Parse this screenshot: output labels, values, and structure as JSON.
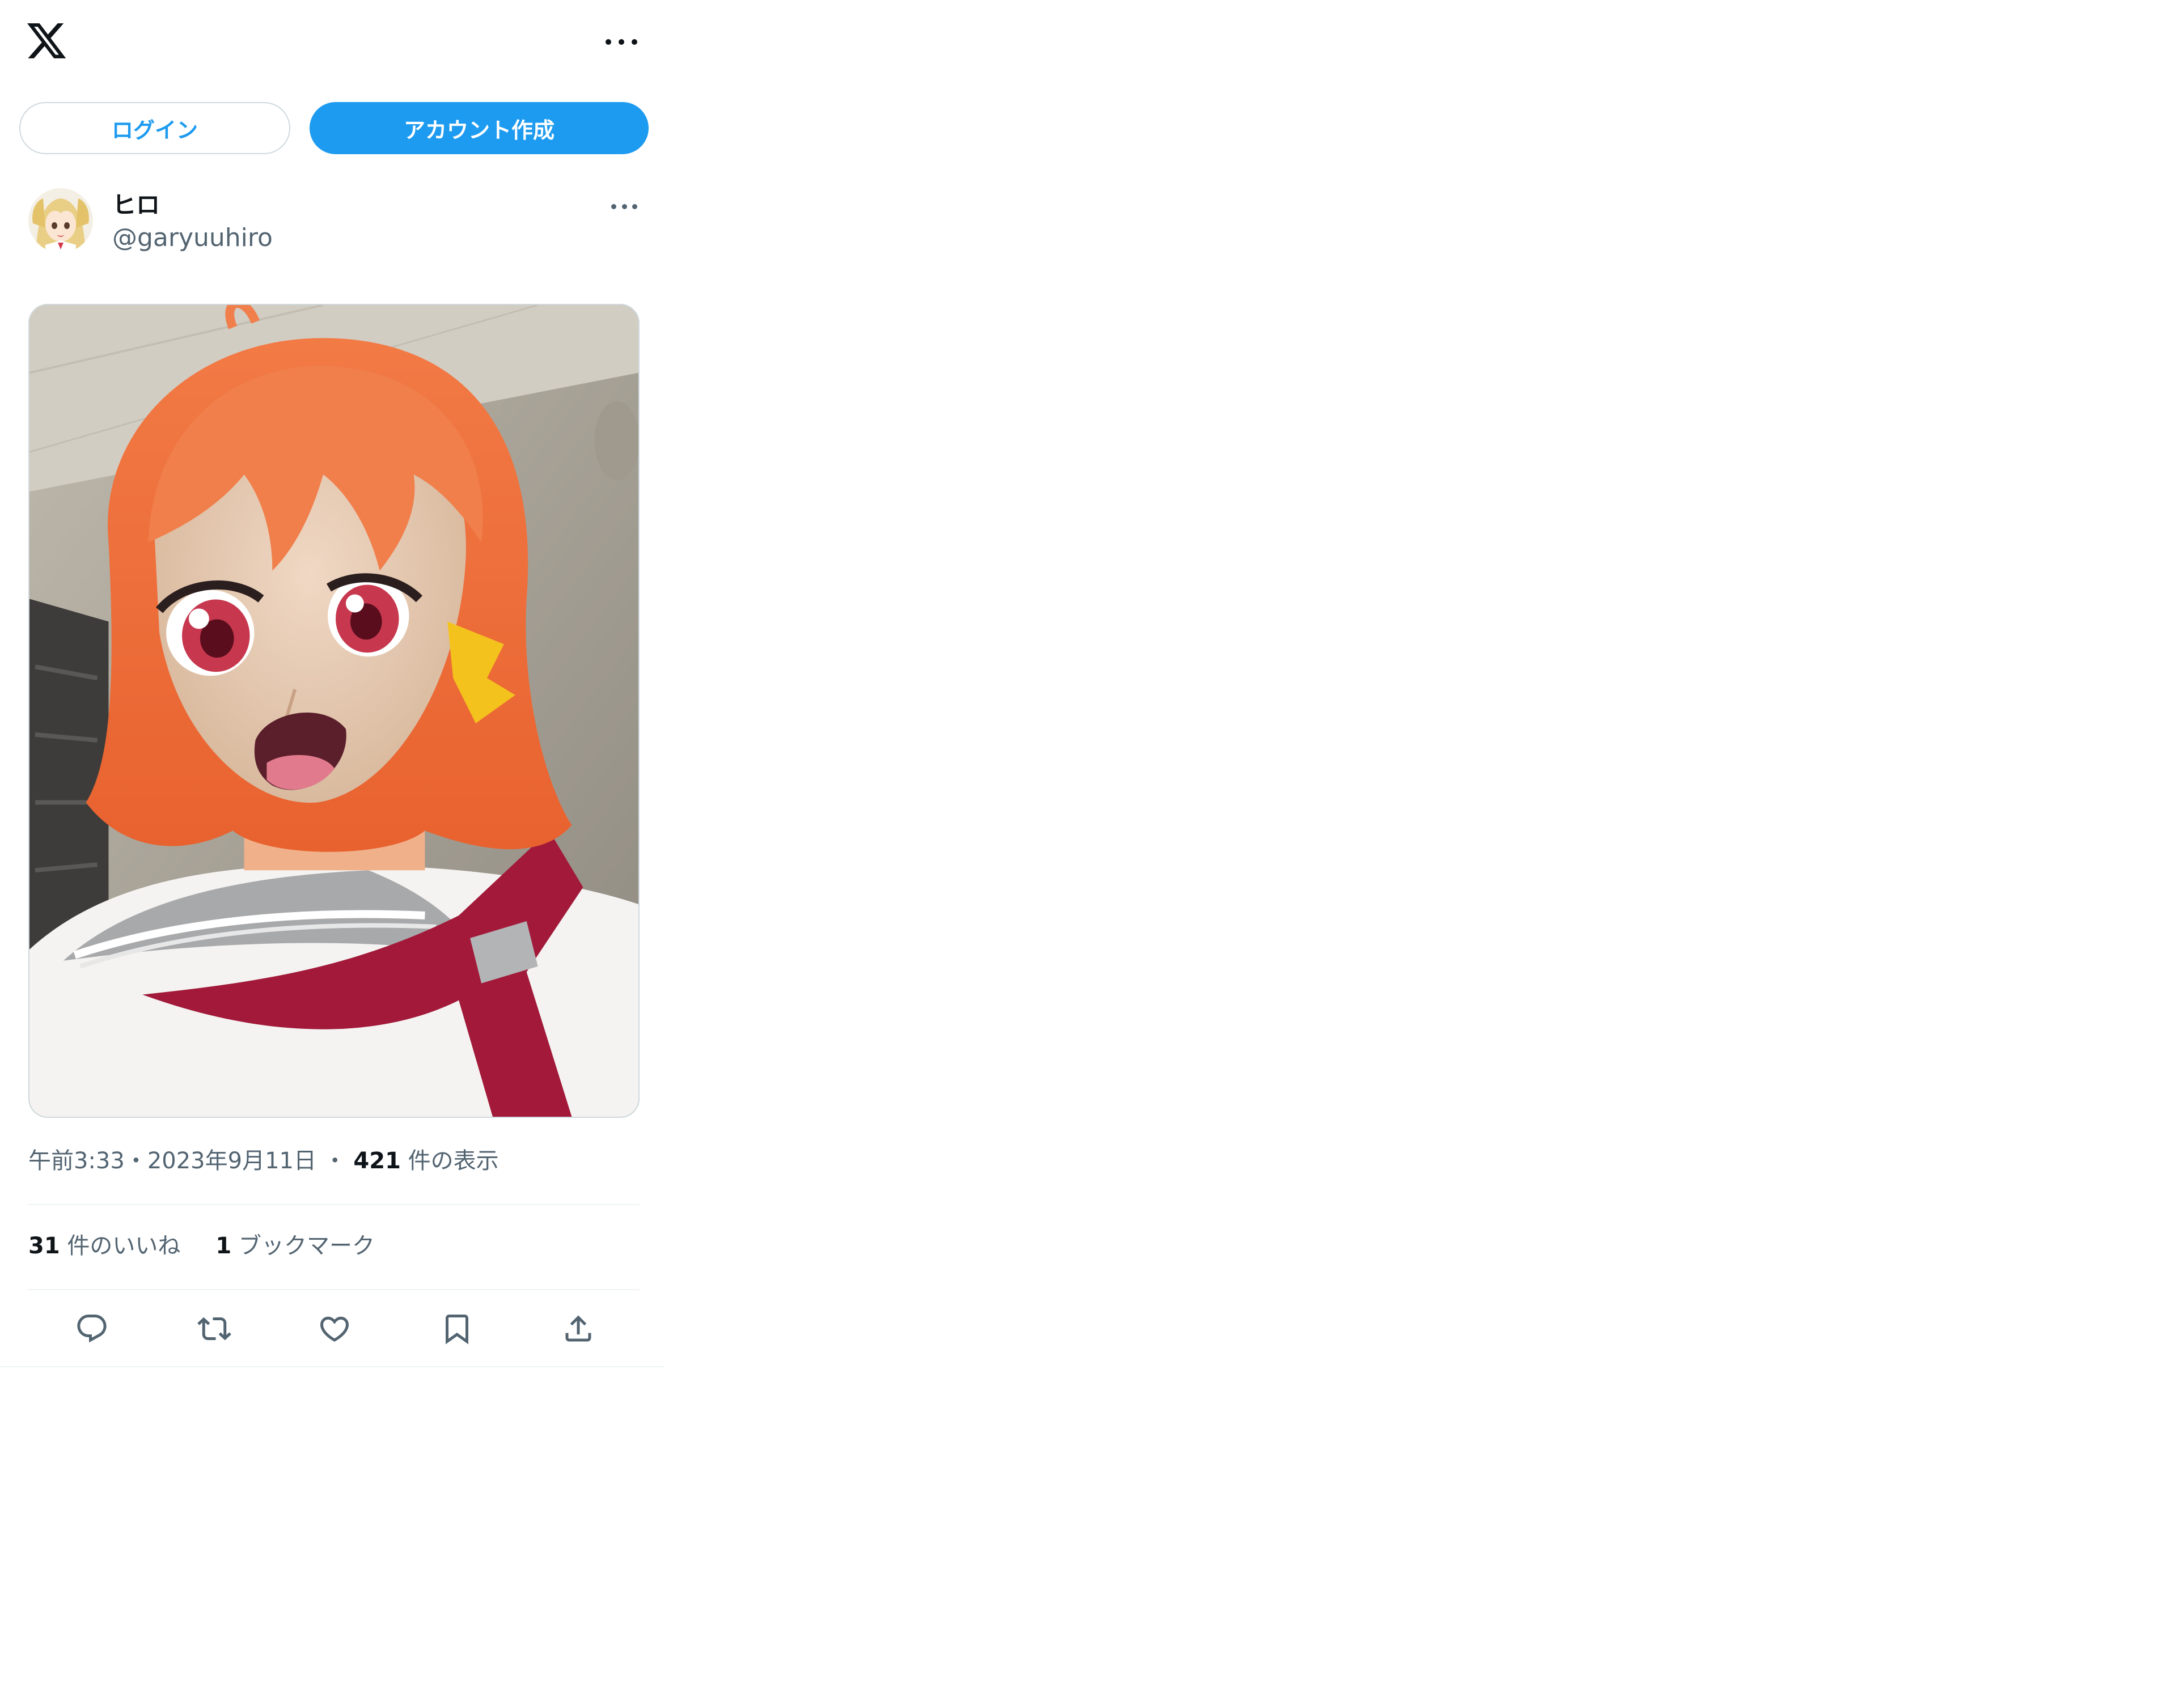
{
  "header": {
    "logo_icon": "x-logo-icon",
    "more_icon": "more-horizontal-icon"
  },
  "auth": {
    "login_label": "ログイン",
    "signup_label": "アカウント作成",
    "signup_color": "#1d9bf0"
  },
  "tweet": {
    "author": {
      "display_name": "ヒロ",
      "handle": "@garyuuhiro"
    },
    "media_icon": "photo-image",
    "time": "午前3:33",
    "separator": "・",
    "date": "2023年9月11日",
    "views_count": "421",
    "views_label": " 件の表示",
    "likes_count": "31",
    "likes_label": " 件のいいね",
    "bookmarks_count": "1",
    "bookmarks_label": " ブックマーク"
  },
  "actions": [
    {
      "icon": "reply-icon"
    },
    {
      "icon": "retweet-icon"
    },
    {
      "icon": "like-icon"
    },
    {
      "icon": "bookmark-icon"
    },
    {
      "icon": "share-icon"
    }
  ]
}
